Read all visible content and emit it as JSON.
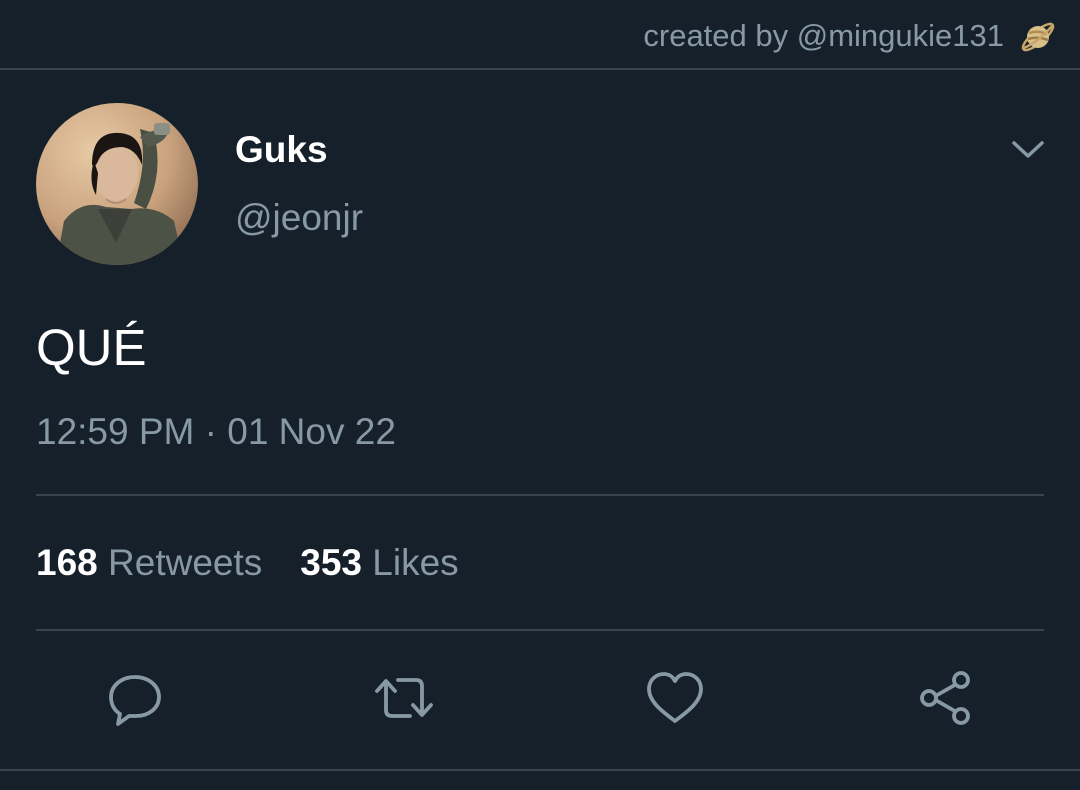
{
  "credit": {
    "text": "created by @mingukie131",
    "icon": "ringed-planet-icon"
  },
  "tweet": {
    "author": {
      "display_name": "Guks",
      "handle": "@jeonjr",
      "avatar_icon": "profile-photo"
    },
    "text": "QUÉ",
    "timestamp": "12:59 PM · 01 Nov 22",
    "retweets_count": "168",
    "retweets_label": "Retweets",
    "likes_count": "353",
    "likes_label": "Likes"
  },
  "actions": [
    "reply-icon",
    "retweet-icon",
    "like-icon",
    "share-icon"
  ],
  "colors": {
    "background": "#15202b",
    "divider": "#38444d",
    "secondary_text": "#8899a6",
    "primary_text": "#ffffff"
  }
}
